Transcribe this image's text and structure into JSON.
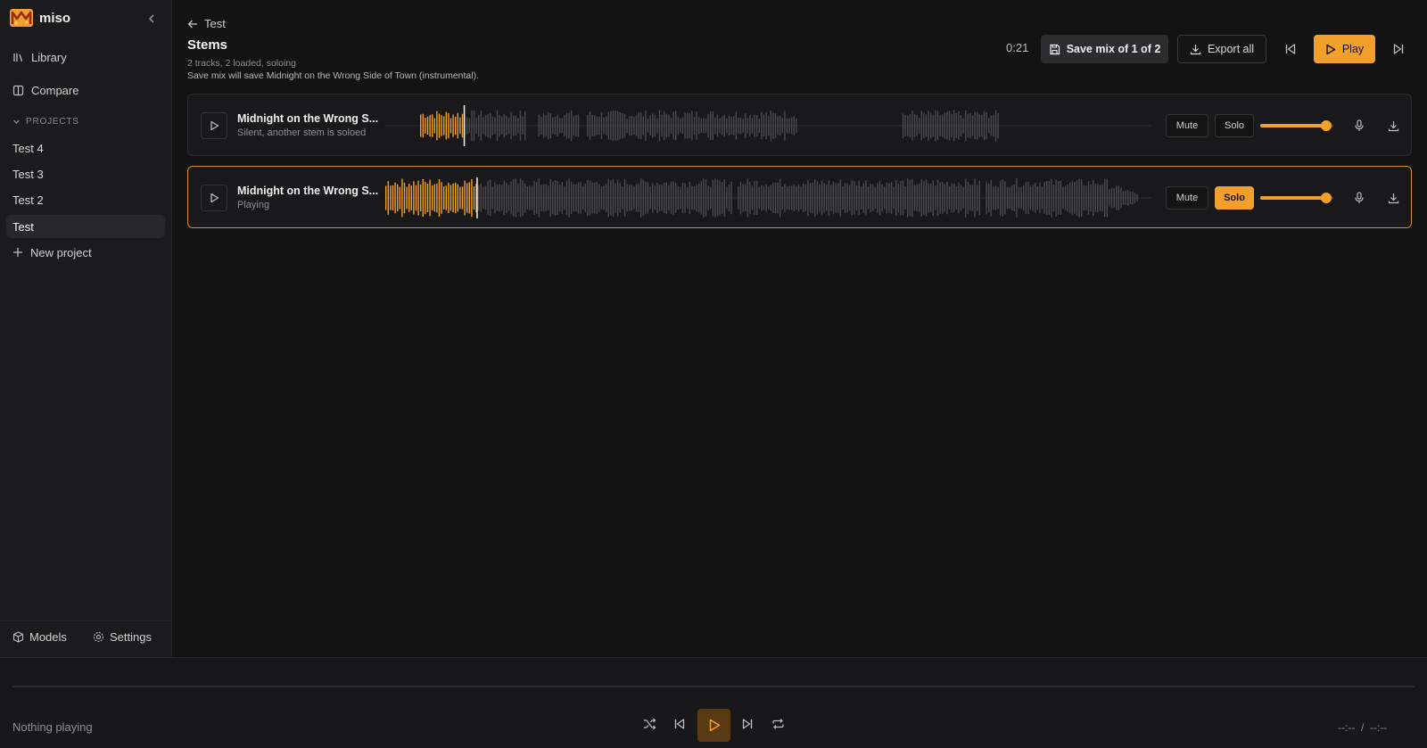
{
  "app": {
    "name": "miso"
  },
  "sidebar": {
    "nav": [
      {
        "label": "Library",
        "icon": "library-icon"
      },
      {
        "label": "Compare",
        "icon": "compare-icon"
      }
    ],
    "projects_label": "PROJECTS",
    "projects": [
      {
        "label": "Test 4",
        "active": false
      },
      {
        "label": "Test 3",
        "active": false
      },
      {
        "label": "Test 2",
        "active": false
      },
      {
        "label": "Test",
        "active": true
      }
    ],
    "new_project": "New project",
    "bottom": {
      "models": "Models",
      "settings": "Settings"
    }
  },
  "header": {
    "back_label": "Test",
    "title": "Stems",
    "summary": "2 tracks, 2 loaded, soloing",
    "save_note": "Save mix will save Midnight on the Wrong Side of Town (instrumental).",
    "time": "0:21",
    "save_button": "Save mix of 1 of 2",
    "export_button": "Export all",
    "play_button": "Play"
  },
  "tracks": [
    {
      "name": "Midnight on the Wrong S...",
      "status": "Silent, another stem is soloed",
      "mute": "Mute",
      "solo": "Solo",
      "solo_on": false,
      "volume": 0.9,
      "progress": 0.08
    },
    {
      "name": "Midnight on the Wrong S...",
      "status": "Playing",
      "mute": "Mute",
      "solo": "Solo",
      "solo_on": true,
      "volume": 0.9,
      "progress": 0.12
    }
  ],
  "player": {
    "now_playing": "Nothing playing",
    "time": "--:--  /  --:--"
  },
  "colors": {
    "accent": "#f29f2c",
    "background": "#131314",
    "sidebar": "#1b1b1d",
    "wave_inactive": "#4a4a4e"
  }
}
